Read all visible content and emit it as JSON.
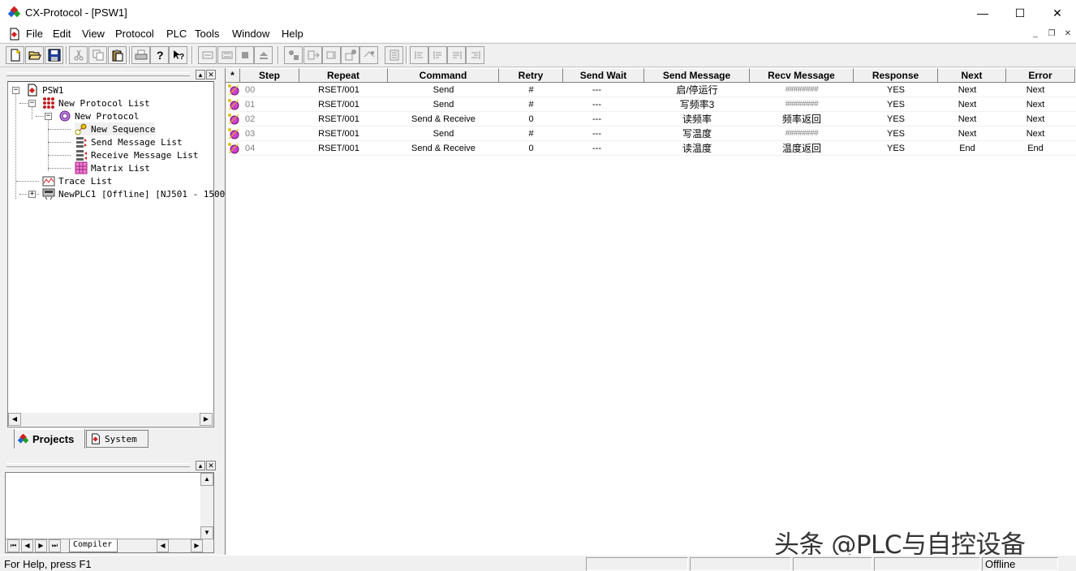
{
  "window": {
    "title": "CX-Protocol - [PSW1]",
    "minimize": "—",
    "maximize": "☐",
    "close": "✕"
  },
  "menu": {
    "items": [
      "File",
      "Edit",
      "View",
      "Protocol",
      "PLC",
      "Tools",
      "Window",
      "Help"
    ],
    "mdi_min": "_",
    "mdi_restore": "❐",
    "mdi_close": "✕"
  },
  "tree": {
    "items": [
      {
        "label": "PSW1",
        "icon": "project-icon"
      },
      {
        "label": "New Protocol List",
        "icon": "protocol-list-icon"
      },
      {
        "label": "New Protocol",
        "icon": "protocol-icon"
      },
      {
        "label": "New Sequence",
        "icon": "sequence-icon"
      },
      {
        "label": "Send Message List",
        "icon": "send-message-list-icon"
      },
      {
        "label": "Receive Message List",
        "icon": "receive-message-list-icon"
      },
      {
        "label": "Matrix List",
        "icon": "matrix-list-icon"
      },
      {
        "label": "Trace List",
        "icon": "trace-list-icon"
      },
      {
        "label": "NewPLC1 [Offline] [NJ501 - 1500",
        "icon": "plc-icon"
      }
    ]
  },
  "tabs": {
    "projects": "Projects",
    "system": "System"
  },
  "output": {
    "compiler_tab": "Compiler"
  },
  "grid": {
    "columns": [
      "*",
      "Step",
      "Repeat",
      "Command",
      "Retry",
      "Send Wait",
      "Send Message",
      "Recv Message",
      "Response",
      "Next",
      "Error"
    ],
    "rows": [
      {
        "step": "00",
        "repeat": "RSET/001",
        "command": "Send",
        "retry": "#",
        "send_wait": "---",
        "send_message": "启/停运行",
        "recv_message": "########",
        "response": "YES",
        "next": "Next",
        "error": "Next"
      },
      {
        "step": "01",
        "repeat": "RSET/001",
        "command": "Send",
        "retry": "#",
        "send_wait": "---",
        "send_message": "写频率3",
        "recv_message": "########",
        "response": "YES",
        "next": "Next",
        "error": "Next"
      },
      {
        "step": "02",
        "repeat": "RSET/001",
        "command": "Send & Receive",
        "retry": "0",
        "send_wait": "---",
        "send_message": "读频率",
        "recv_message": "频率返回",
        "response": "YES",
        "next": "Next",
        "error": "Next"
      },
      {
        "step": "03",
        "repeat": "RSET/001",
        "command": "Send",
        "retry": "#",
        "send_wait": "---",
        "send_message": "写温度",
        "recv_message": "########",
        "response": "YES",
        "next": "Next",
        "error": "Next"
      },
      {
        "step": "04",
        "repeat": "RSET/001",
        "command": "Send & Receive",
        "retry": "0",
        "send_wait": "---",
        "send_message": "读温度",
        "recv_message": "温度返回",
        "response": "YES",
        "next": "End",
        "error": "End"
      }
    ]
  },
  "status": {
    "help": "For Help, press F1",
    "mode": "Offline"
  },
  "watermark": "头条 @PLC与自控设备"
}
